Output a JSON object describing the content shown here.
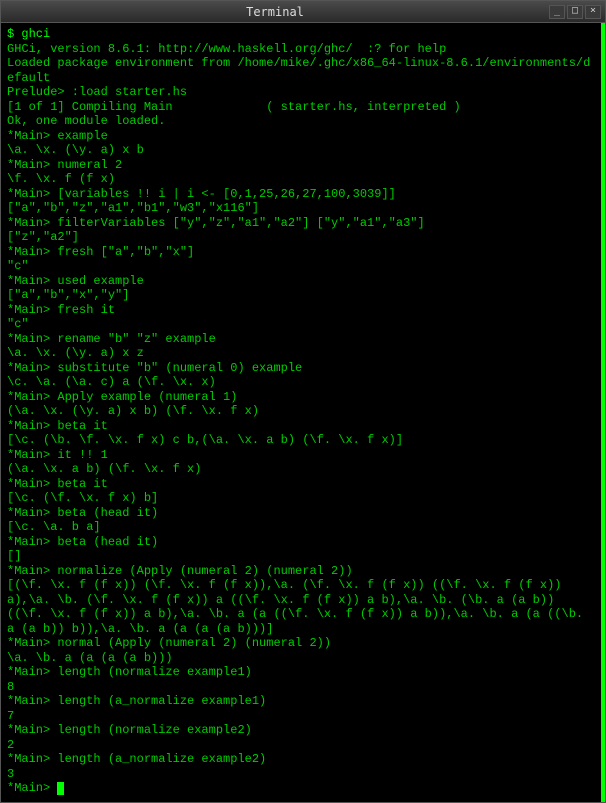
{
  "window": {
    "title": "Terminal"
  },
  "lines": [
    {
      "cls": "prompt-shell",
      "text": "$ ghci"
    },
    {
      "cls": "output",
      "text": "GHCi, version 8.6.1: http://www.haskell.org/ghc/  :? for help"
    },
    {
      "cls": "output",
      "text": "Loaded package environment from /home/mike/.ghc/x86_64-linux-8.6.1/environments/default"
    },
    {
      "cls": "output",
      "text": "Prelude> :load starter.hs"
    },
    {
      "cls": "output",
      "text": "[1 of 1] Compiling Main             ( starter.hs, interpreted )"
    },
    {
      "cls": "output",
      "text": "Ok, one module loaded."
    },
    {
      "cls": "output",
      "text": "*Main> example"
    },
    {
      "cls": "output",
      "text": "\\a. \\x. (\\y. a) x b"
    },
    {
      "cls": "output",
      "text": "*Main> numeral 2"
    },
    {
      "cls": "output",
      "text": "\\f. \\x. f (f x)"
    },
    {
      "cls": "output",
      "text": "*Main> [variables !! i | i <- [0,1,25,26,27,100,3039]]"
    },
    {
      "cls": "output",
      "text": "[\"a\",\"b\",\"z\",\"a1\",\"b1\",\"w3\",\"x116\"]"
    },
    {
      "cls": "output",
      "text": "*Main> filterVariables [\"y\",\"z\",\"a1\",\"a2\"] [\"y\",\"a1\",\"a3\"]"
    },
    {
      "cls": "output",
      "text": "[\"z\",\"a2\"]"
    },
    {
      "cls": "output",
      "text": "*Main> fresh [\"a\",\"b\",\"x\"]"
    },
    {
      "cls": "output",
      "text": "\"c\""
    },
    {
      "cls": "output",
      "text": "*Main> used example"
    },
    {
      "cls": "output",
      "text": "[\"a\",\"b\",\"x\",\"y\"]"
    },
    {
      "cls": "output",
      "text": "*Main> fresh it"
    },
    {
      "cls": "output",
      "text": "\"c\""
    },
    {
      "cls": "output",
      "text": "*Main> rename \"b\" \"z\" example"
    },
    {
      "cls": "output",
      "text": "\\a. \\x. (\\y. a) x z"
    },
    {
      "cls": "output",
      "text": "*Main> substitute \"b\" (numeral 0) example"
    },
    {
      "cls": "output",
      "text": "\\c. \\a. (\\a. c) a (\\f. \\x. x)"
    },
    {
      "cls": "output",
      "text": "*Main> Apply example (numeral 1)"
    },
    {
      "cls": "output",
      "text": "(\\a. \\x. (\\y. a) x b) (\\f. \\x. f x)"
    },
    {
      "cls": "output",
      "text": "*Main> beta it"
    },
    {
      "cls": "output",
      "text": "[\\c. (\\b. \\f. \\x. f x) c b,(\\a. \\x. a b) (\\f. \\x. f x)]"
    },
    {
      "cls": "output",
      "text": "*Main> it !! 1"
    },
    {
      "cls": "output",
      "text": "(\\a. \\x. a b) (\\f. \\x. f x)"
    },
    {
      "cls": "output",
      "text": "*Main> beta it"
    },
    {
      "cls": "output",
      "text": "[\\c. (\\f. \\x. f x) b]"
    },
    {
      "cls": "output",
      "text": "*Main> beta (head it)"
    },
    {
      "cls": "output",
      "text": "[\\c. \\a. b a]"
    },
    {
      "cls": "output",
      "text": "*Main> beta (head it)"
    },
    {
      "cls": "output",
      "text": "[]"
    },
    {
      "cls": "output",
      "text": "*Main> normalize (Apply (numeral 2) (numeral 2))"
    },
    {
      "cls": "output",
      "text": "[(\\f. \\x. f (f x)) (\\f. \\x. f (f x)),\\a. (\\f. \\x. f (f x)) ((\\f. \\x. f (f x)) a),\\a. \\b. (\\f. \\x. f (f x)) a ((\\f. \\x. f (f x)) a b),\\a. \\b. (\\b. a (a b)) ((\\f. \\x. f (f x)) a b),\\a. \\b. a (a ((\\f. \\x. f (f x)) a b)),\\a. \\b. a (a ((\\b. a (a b)) b)),\\a. \\b. a (a (a (a b)))]"
    },
    {
      "cls": "output",
      "text": "*Main> normal (Apply (numeral 2) (numeral 2))"
    },
    {
      "cls": "output",
      "text": "\\a. \\b. a (a (a (a b)))"
    },
    {
      "cls": "output",
      "text": "*Main> length (normalize example1)"
    },
    {
      "cls": "output",
      "text": "8"
    },
    {
      "cls": "output",
      "text": "*Main> length (a_normalize example1)"
    },
    {
      "cls": "output",
      "text": "7"
    },
    {
      "cls": "output",
      "text": "*Main> length (normalize example2)"
    },
    {
      "cls": "output",
      "text": "2"
    },
    {
      "cls": "output",
      "text": "*Main> length (a_normalize example2)"
    },
    {
      "cls": "output",
      "text": "3"
    },
    {
      "cls": "output",
      "text": "*Main> ",
      "cursor": true
    }
  ],
  "buttons": {
    "min": "_",
    "max": "□",
    "close": "×"
  }
}
